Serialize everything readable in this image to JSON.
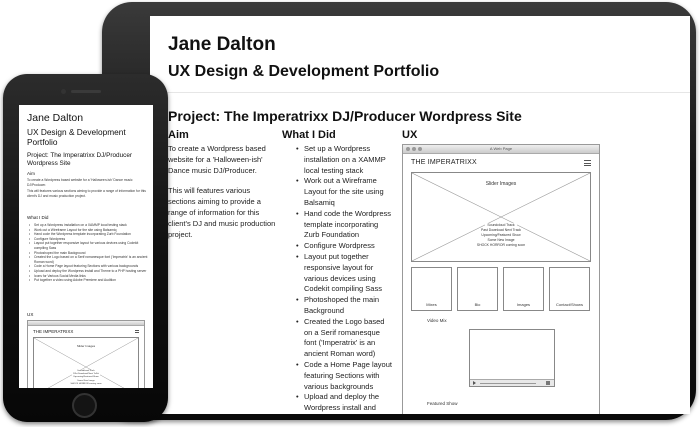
{
  "portfolio": {
    "name": "Jane Dalton",
    "subtitle": "UX Design & Development Portfolio",
    "project_title": "Project: The Imperatrixx DJ/Producer Wordpress Site"
  },
  "columns": {
    "aim": "Aim",
    "what_i_did": "What I Did",
    "ux": "UX"
  },
  "aim_paragraphs": [
    "To create a Wordpress based website for a 'Halloween-ish' Dance music DJ/Producer.",
    "This will features various sections aiming to provide a range of information for this client's DJ and music production project."
  ],
  "what_i_did": [
    "Set up a Wordpress installation on a XAMMP local testing stack",
    "Work out a Wireframe Layout for the site using Balsamiq",
    "Hand code the Wordpress template incorporating Zurb Foundation",
    "Configure Wordpress",
    "Layout put together responsive layout for various devices using Codekit compiling Sass",
    "Photoshoped the main Background",
    "Created the Logo based on a Serif romanesque font ('Imperatrix' is an ancient Roman word)",
    "Code a Home Page layout featuring Sections with various backgrounds",
    "Upload and deploy the Wordpress install and"
  ],
  "phone_what_i_did": [
    "Set up a Wordpress installation on a XAMMP local testing stack",
    "Work out a Wireframe Layout for the site using Balsamiq",
    "Hand code the Wordpress template incorporating Zurb Foundation",
    "Configure Wordpress",
    "Layout put together responsive layout for various devices using Codekit compiling Sass",
    "Photoshoped the main Background",
    "Created the Logo based on a Serif romanesque font ('Imperatrix' is an ancient Roman word)",
    "Code a Home Page layout featuring Sections with various backgrounds",
    "Upload and deploy the Wordpress install and Theme to a PHP hosting server",
    "Icons for Various Social Media links",
    "Put together a video using Adobe Premiere and Audition"
  ],
  "wireframe": {
    "window_title": "A Web Page",
    "site_title": "THE IMPERATRIXX",
    "slider_label": "Slider Images",
    "slider_lines": [
      "Soundcloud Track",
      "Past Download Next Track",
      "Upcoming/Featured Show",
      "Some New Image",
      "SHOCK HORROR coming soon"
    ],
    "tiles": [
      "Mixes",
      "Bio",
      "Images",
      "Contact/Shows"
    ],
    "video_label": "Video Mix",
    "featured_label": "Featured Show"
  },
  "icons": {
    "menu": "hamburger-menu-icon",
    "play": "play-icon",
    "volume": "volume-icon"
  },
  "colors": {
    "device_frame": "#111111",
    "screen_bg": "#ffffff",
    "wireframe_line": "#888888"
  }
}
